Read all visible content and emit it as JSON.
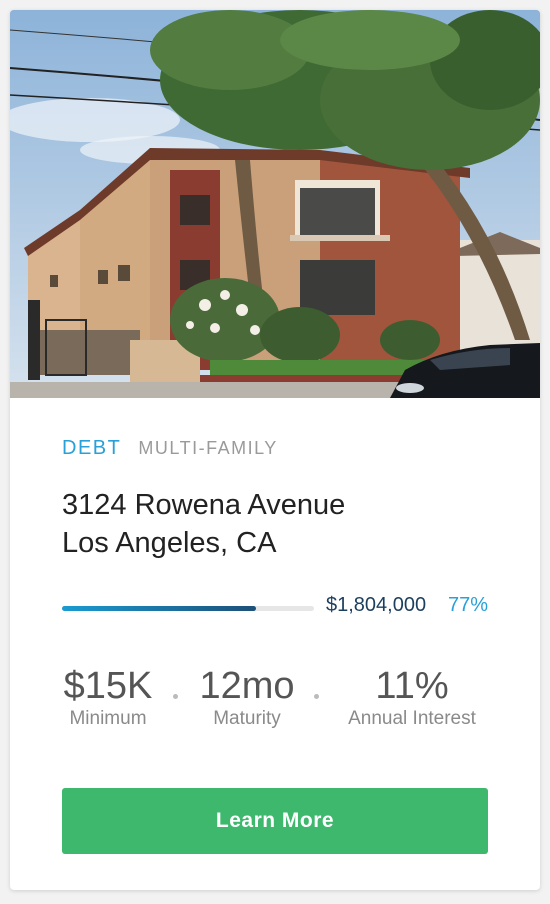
{
  "listing": {
    "loan_type": "DEBT",
    "property_type": "MULTI-FAMILY",
    "address_line1": "3124 Rowena Avenue",
    "address_line2": "Los Angeles, CA",
    "amount": "$1,804,000",
    "funded_percent_label": "77%",
    "funded_fraction": 0.77
  },
  "stats": [
    {
      "value": "$15K",
      "label": "Minimum"
    },
    {
      "value": "12mo",
      "label": "Maturity"
    },
    {
      "value": "11%",
      "label": "Annual Interest"
    }
  ],
  "cta": {
    "label": "Learn More"
  },
  "colors": {
    "accent_blue": "#2aa0d8",
    "progress_dark": "#1d4f78",
    "button_green": "#3db86d"
  }
}
